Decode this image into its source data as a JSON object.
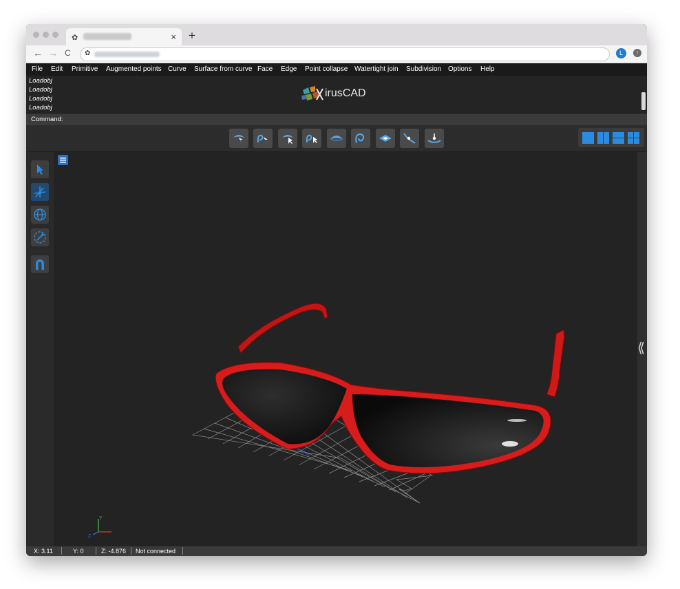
{
  "browser": {
    "tab_close": "×",
    "new_tab": "+",
    "back": "←",
    "forward": "→",
    "reload": "C",
    "profile_initial": "L",
    "extension_glyph": "↑"
  },
  "menu": [
    "File",
    "Edit",
    "Primitive",
    "Augmented points",
    "Curve",
    "Surface from curve",
    "Face",
    "Edge",
    "Point collapse",
    "Watertight join",
    "Subdivision",
    "Options",
    "Help"
  ],
  "log": [
    "Loadobj",
    "Loadobj",
    "Loadobj",
    "Loadobj"
  ],
  "logo": {
    "text": "irusCAD",
    "accent": "#d9822b"
  },
  "command": {
    "label": "Command:"
  },
  "toolbar_icons": [
    "surface-select-icon",
    "curve-select-icon",
    "surface-pick-icon",
    "curve-pick-icon",
    "surface-icon",
    "curve-loop-icon",
    "plane-icon",
    "point-curve-icon",
    "surface-point-icon"
  ],
  "layout_icons": [
    "single-view-icon",
    "two-vertical-view-icon",
    "two-horizontal-view-icon",
    "four-view-icon"
  ],
  "left_tools": [
    "pointer-icon",
    "transform-icon",
    "globe-icon",
    "orbit-icon",
    "magnet-icon"
  ],
  "viewport": {
    "collapse_glyph": "⟪",
    "object_color": "#d81c1c",
    "lens_color": "#101010"
  },
  "axis": {
    "y": "Y",
    "z": "Z"
  },
  "status": {
    "x": "X: 3.11",
    "y": "Y: 0",
    "z": "Z: -4.876",
    "connection": "Not connected"
  },
  "colors": {
    "accent": "#2a8be0",
    "menu_bg": "#1a1a1a",
    "viewport_bg": "#232323"
  }
}
